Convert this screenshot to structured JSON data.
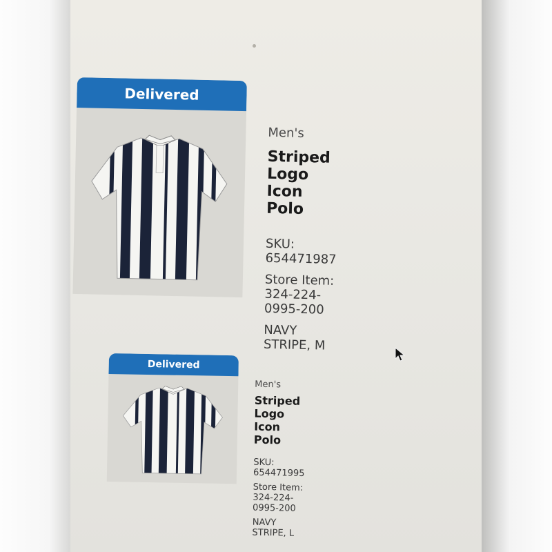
{
  "orders": [
    {
      "status": "Delivered",
      "category": "Men's",
      "name": "Striped Logo Icon Polo",
      "sku": "SKU: 654471987",
      "store_item": "Store Item: 324-224-0995-200",
      "variant": "NAVY STRIPE, M"
    },
    {
      "status": "Delivered",
      "category": "Men's",
      "name": "Striped Logo Icon Polo",
      "sku": "SKU: 654471995",
      "store_item": "Store Item: 324-224-0995-200",
      "variant": "NAVY STRIPE, L"
    }
  ],
  "colors": {
    "badge": "#1f6fb8",
    "stripe_navy": "#1b2338",
    "stripe_white": "#f5f5f2",
    "screen": "#eceae4"
  },
  "icons": {
    "cursor": "mouse-pointer-icon"
  }
}
